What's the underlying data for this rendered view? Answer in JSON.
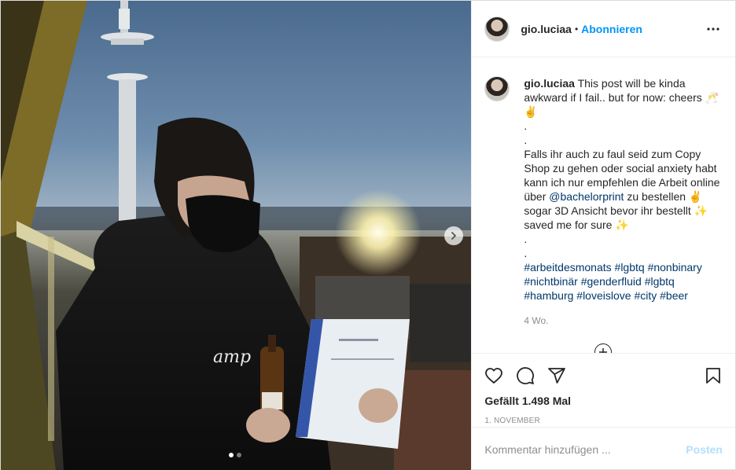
{
  "post": {
    "username": "gio.luciaa",
    "follow_label": "Abonnieren",
    "separator": "•",
    "caption_intro": " This post will be kinda awkward if I fail.. but for now: cheers 🥂✌️\n.\n.\nFalls ihr auch zu faul seid zum Copy Shop zu gehen oder social anxiety habt kann ich nur empfehlen die Arbeit online über ",
    "mention": "@bachelorprint",
    "caption_middle": " zu bestellen ✌️ sogar 3D Ansicht bevor ihr bestellt ✨ saved me for sure ✨\n.\n.\n",
    "hashtags": "#arbeitdesmonats #lgbtq #nonbinary #nichtbinär #genderfluid #lgbtq #hamburg #loveislove #city #beer",
    "relative_time": "4 Wo.",
    "likes_label": "Gefällt 1.498 Mal",
    "date": "1. November",
    "comment_placeholder": "Kommentar hinzufügen ...",
    "post_button": "Posten"
  },
  "icons": {
    "more": "more-options-icon",
    "heart": "heart-icon",
    "comment": "comment-icon",
    "share": "share-icon",
    "bookmark": "bookmark-icon",
    "next": "chevron-right-icon",
    "load_more": "plus-circle-icon"
  },
  "carousel": {
    "total": 2,
    "active": 1
  },
  "colors": {
    "accent": "#0095f6",
    "link": "#00376b",
    "muted": "#8e8e8e",
    "post_disabled": "#b2dffc"
  }
}
